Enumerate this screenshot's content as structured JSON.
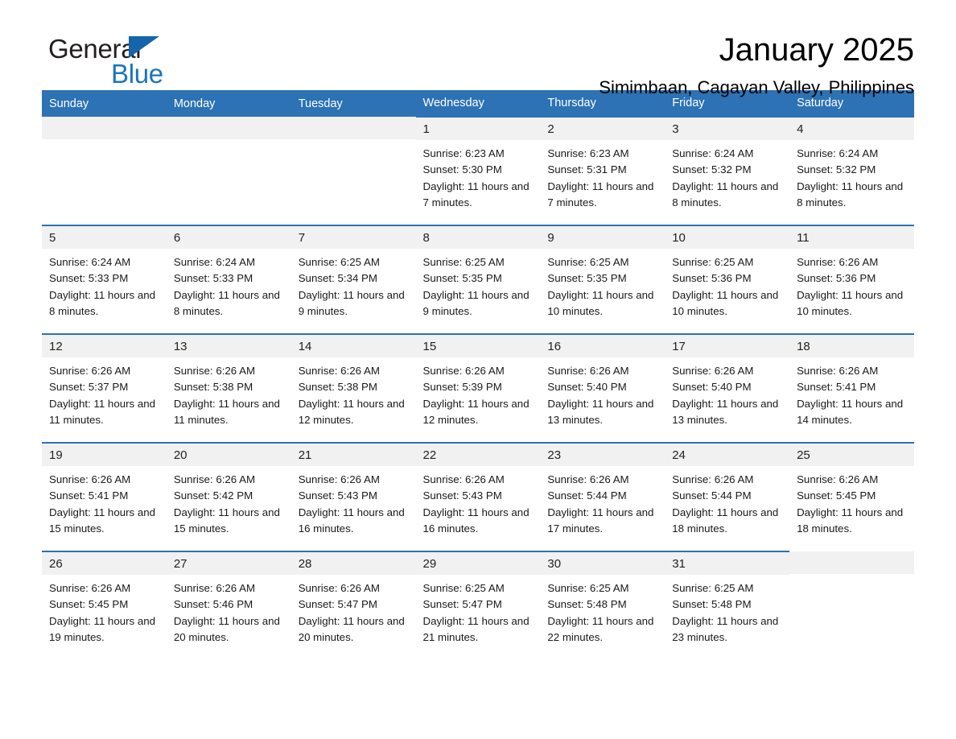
{
  "brand": {
    "name_top": "General",
    "name_bottom": "Blue",
    "logo_icon": "triangle-icon",
    "color_black": "#231f20",
    "color_blue": "#1976bc"
  },
  "header": {
    "title": "January 2025",
    "location": "Simimbaan, Cagayan Valley, Philippines",
    "accent_color": "#2c72b4",
    "band_color": "#f1f1f1"
  },
  "weekday_headers": [
    "Sunday",
    "Monday",
    "Tuesday",
    "Wednesday",
    "Thursday",
    "Friday",
    "Saturday"
  ],
  "weeks": [
    [
      {
        "day": ""
      },
      {
        "day": ""
      },
      {
        "day": ""
      },
      {
        "day": "1",
        "sunrise": "Sunrise: 6:23 AM",
        "sunset": "Sunset: 5:30 PM",
        "daylight": "Daylight: 11 hours and 7 minutes."
      },
      {
        "day": "2",
        "sunrise": "Sunrise: 6:23 AM",
        "sunset": "Sunset: 5:31 PM",
        "daylight": "Daylight: 11 hours and 7 minutes."
      },
      {
        "day": "3",
        "sunrise": "Sunrise: 6:24 AM",
        "sunset": "Sunset: 5:32 PM",
        "daylight": "Daylight: 11 hours and 8 minutes."
      },
      {
        "day": "4",
        "sunrise": "Sunrise: 6:24 AM",
        "sunset": "Sunset: 5:32 PM",
        "daylight": "Daylight: 11 hours and 8 minutes."
      }
    ],
    [
      {
        "day": "5",
        "sunrise": "Sunrise: 6:24 AM",
        "sunset": "Sunset: 5:33 PM",
        "daylight": "Daylight: 11 hours and 8 minutes."
      },
      {
        "day": "6",
        "sunrise": "Sunrise: 6:24 AM",
        "sunset": "Sunset: 5:33 PM",
        "daylight": "Daylight: 11 hours and 8 minutes."
      },
      {
        "day": "7",
        "sunrise": "Sunrise: 6:25 AM",
        "sunset": "Sunset: 5:34 PM",
        "daylight": "Daylight: 11 hours and 9 minutes."
      },
      {
        "day": "8",
        "sunrise": "Sunrise: 6:25 AM",
        "sunset": "Sunset: 5:35 PM",
        "daylight": "Daylight: 11 hours and 9 minutes."
      },
      {
        "day": "9",
        "sunrise": "Sunrise: 6:25 AM",
        "sunset": "Sunset: 5:35 PM",
        "daylight": "Daylight: 11 hours and 10 minutes."
      },
      {
        "day": "10",
        "sunrise": "Sunrise: 6:25 AM",
        "sunset": "Sunset: 5:36 PM",
        "daylight": "Daylight: 11 hours and 10 minutes."
      },
      {
        "day": "11",
        "sunrise": "Sunrise: 6:26 AM",
        "sunset": "Sunset: 5:36 PM",
        "daylight": "Daylight: 11 hours and 10 minutes."
      }
    ],
    [
      {
        "day": "12",
        "sunrise": "Sunrise: 6:26 AM",
        "sunset": "Sunset: 5:37 PM",
        "daylight": "Daylight: 11 hours and 11 minutes."
      },
      {
        "day": "13",
        "sunrise": "Sunrise: 6:26 AM",
        "sunset": "Sunset: 5:38 PM",
        "daylight": "Daylight: 11 hours and 11 minutes."
      },
      {
        "day": "14",
        "sunrise": "Sunrise: 6:26 AM",
        "sunset": "Sunset: 5:38 PM",
        "daylight": "Daylight: 11 hours and 12 minutes."
      },
      {
        "day": "15",
        "sunrise": "Sunrise: 6:26 AM",
        "sunset": "Sunset: 5:39 PM",
        "daylight": "Daylight: 11 hours and 12 minutes."
      },
      {
        "day": "16",
        "sunrise": "Sunrise: 6:26 AM",
        "sunset": "Sunset: 5:40 PM",
        "daylight": "Daylight: 11 hours and 13 minutes."
      },
      {
        "day": "17",
        "sunrise": "Sunrise: 6:26 AM",
        "sunset": "Sunset: 5:40 PM",
        "daylight": "Daylight: 11 hours and 13 minutes."
      },
      {
        "day": "18",
        "sunrise": "Sunrise: 6:26 AM",
        "sunset": "Sunset: 5:41 PM",
        "daylight": "Daylight: 11 hours and 14 minutes."
      }
    ],
    [
      {
        "day": "19",
        "sunrise": "Sunrise: 6:26 AM",
        "sunset": "Sunset: 5:41 PM",
        "daylight": "Daylight: 11 hours and 15 minutes."
      },
      {
        "day": "20",
        "sunrise": "Sunrise: 6:26 AM",
        "sunset": "Sunset: 5:42 PM",
        "daylight": "Daylight: 11 hours and 15 minutes."
      },
      {
        "day": "21",
        "sunrise": "Sunrise: 6:26 AM",
        "sunset": "Sunset: 5:43 PM",
        "daylight": "Daylight: 11 hours and 16 minutes."
      },
      {
        "day": "22",
        "sunrise": "Sunrise: 6:26 AM",
        "sunset": "Sunset: 5:43 PM",
        "daylight": "Daylight: 11 hours and 16 minutes."
      },
      {
        "day": "23",
        "sunrise": "Sunrise: 6:26 AM",
        "sunset": "Sunset: 5:44 PM",
        "daylight": "Daylight: 11 hours and 17 minutes."
      },
      {
        "day": "24",
        "sunrise": "Sunrise: 6:26 AM",
        "sunset": "Sunset: 5:44 PM",
        "daylight": "Daylight: 11 hours and 18 minutes."
      },
      {
        "day": "25",
        "sunrise": "Sunrise: 6:26 AM",
        "sunset": "Sunset: 5:45 PM",
        "daylight": "Daylight: 11 hours and 18 minutes."
      }
    ],
    [
      {
        "day": "26",
        "sunrise": "Sunrise: 6:26 AM",
        "sunset": "Sunset: 5:45 PM",
        "daylight": "Daylight: 11 hours and 19 minutes."
      },
      {
        "day": "27",
        "sunrise": "Sunrise: 6:26 AM",
        "sunset": "Sunset: 5:46 PM",
        "daylight": "Daylight: 11 hours and 20 minutes."
      },
      {
        "day": "28",
        "sunrise": "Sunrise: 6:26 AM",
        "sunset": "Sunset: 5:47 PM",
        "daylight": "Daylight: 11 hours and 20 minutes."
      },
      {
        "day": "29",
        "sunrise": "Sunrise: 6:25 AM",
        "sunset": "Sunset: 5:47 PM",
        "daylight": "Daylight: 11 hours and 21 minutes."
      },
      {
        "day": "30",
        "sunrise": "Sunrise: 6:25 AM",
        "sunset": "Sunset: 5:48 PM",
        "daylight": "Daylight: 11 hours and 22 minutes."
      },
      {
        "day": "31",
        "sunrise": "Sunrise: 6:25 AM",
        "sunset": "Sunset: 5:48 PM",
        "daylight": "Daylight: 11 hours and 23 minutes."
      },
      {
        "day": ""
      }
    ]
  ]
}
